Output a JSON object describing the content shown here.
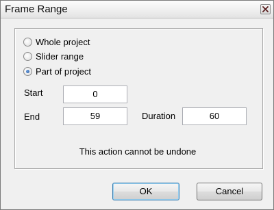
{
  "window": {
    "title": "Frame Range",
    "close_icon": "close-icon"
  },
  "range_options": [
    {
      "label": "Whole project",
      "selected": false
    },
    {
      "label": "Slider range",
      "selected": false
    },
    {
      "label": "Part of project",
      "selected": true
    }
  ],
  "fields": {
    "start": {
      "label": "Start",
      "value": "0"
    },
    "end": {
      "label": "End",
      "value": "59"
    },
    "duration": {
      "label": "Duration",
      "value": "60"
    }
  },
  "message": "This action cannot be undone",
  "buttons": {
    "ok": "OK",
    "cancel": "Cancel"
  }
}
